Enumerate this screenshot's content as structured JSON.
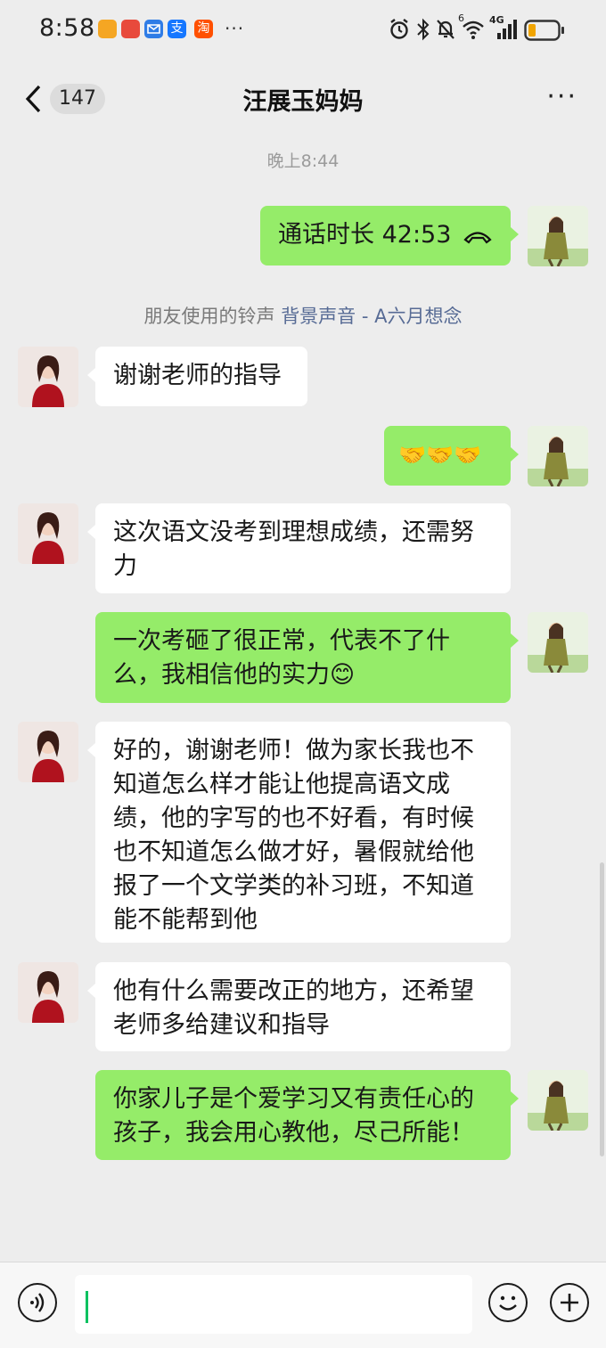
{
  "status": {
    "time": "8:58",
    "app_icons": [
      "orange-app-icon",
      "red-app-icon",
      "mail-icon",
      "alipay-icon",
      "taobao-icon"
    ],
    "app_icon_labels": [
      "",
      "",
      "",
      "支",
      "淘"
    ],
    "more": "···",
    "network_label": "4G",
    "wifi_label": "6"
  },
  "header": {
    "back_count": "147",
    "title": "汪展玉妈妈",
    "more": "···"
  },
  "chat": {
    "timestamp": "晚上8:44",
    "call": {
      "text": "通话时长 42:53",
      "icon": "hangup-phone-icon"
    },
    "ringtone": {
      "prefix": "朋友使用的铃声 ",
      "link": "背景声音 - A六月想念"
    },
    "messages": [
      {
        "side": "in",
        "text": "谢谢老师的指导"
      },
      {
        "side": "out",
        "text": "🤝🤝🤝"
      },
      {
        "side": "in",
        "text": "这次语文没考到理想成绩，还需努力"
      },
      {
        "side": "out",
        "text": "一次考砸了很正常，代表不了什么，我相信他的实力😊"
      },
      {
        "side": "in",
        "text": "好的，谢谢老师！做为家长我也不知道怎么样才能让他提高语文成绩，他的字写的也不好看，有时候也不知道怎么做才好，暑假就给他报了一个文学类的补习班，不知道能不能帮到他"
      },
      {
        "side": "in",
        "text": "他有什么需要改正的地方，还希望老师多给建议和指导"
      },
      {
        "side": "out",
        "text": "你家儿子是个爱学习又有责任心的孩子，我会用心教他，尽己所能！"
      }
    ]
  },
  "input": {
    "value": "",
    "voice_icon": "voice-icon",
    "emoji_icon": "emoji-icon",
    "add_icon": "plus-icon"
  },
  "colors": {
    "background": "#ededed",
    "outgoing_bubble": "#95ec69",
    "incoming_bubble": "#ffffff",
    "link": "#576b95",
    "caret": "#07c160"
  }
}
